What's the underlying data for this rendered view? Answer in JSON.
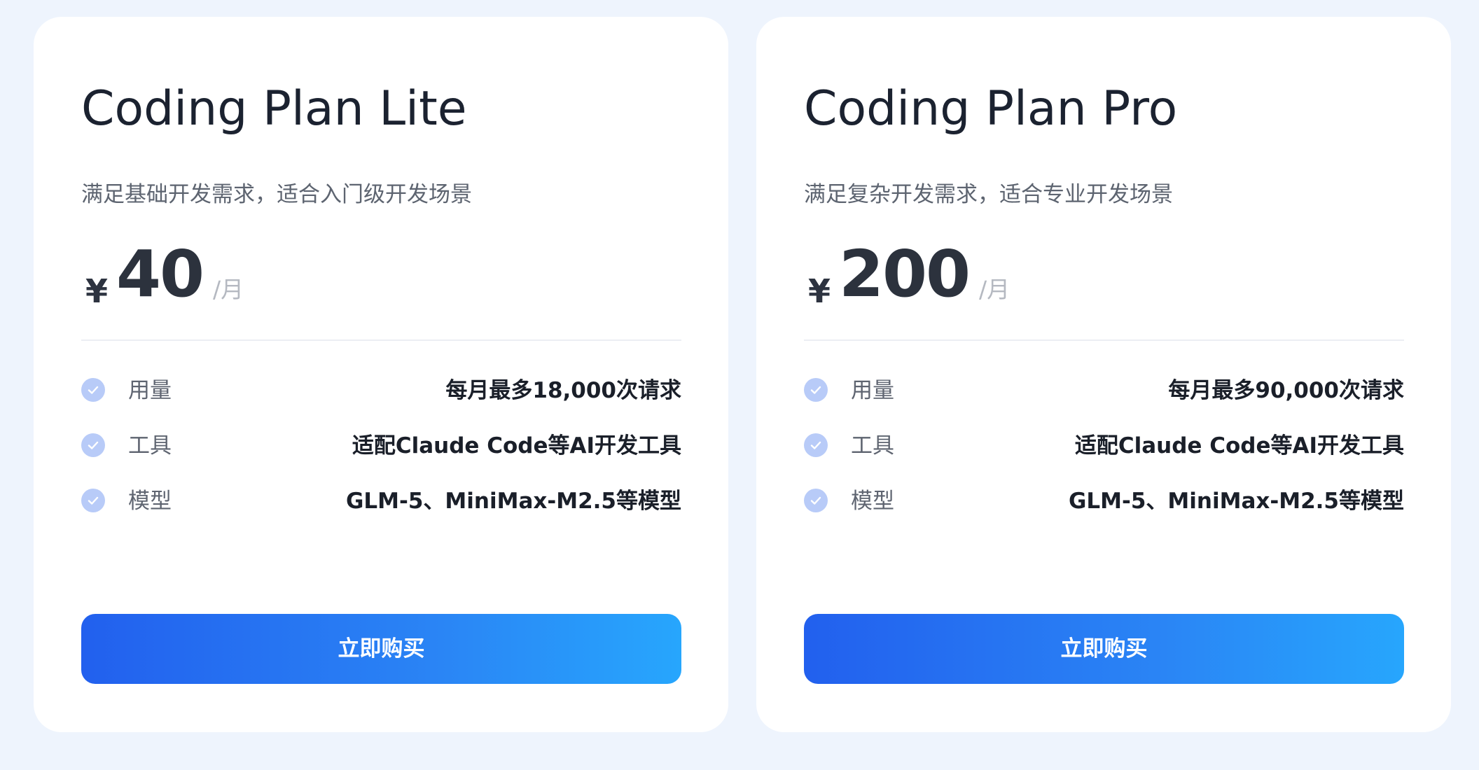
{
  "plans": [
    {
      "title": "Coding Plan Lite",
      "description": "满足基础开发需求，适合入门级开发场景",
      "currency": "¥",
      "price": "40",
      "period": "/月",
      "features": [
        {
          "label": "用量",
          "value": "每月最多18,000次请求",
          "icon": "check-circle-icon"
        },
        {
          "label": "工具",
          "value": "适配Claude Code等AI开发工具",
          "icon": "check-circle-icon"
        },
        {
          "label": "模型",
          "value": "GLM-5、MiniMax-M2.5等模型",
          "icon": "check-circle-icon"
        }
      ],
      "button_label": "立即购买"
    },
    {
      "title": "Coding Plan Pro",
      "description": "满足复杂开发需求，适合专业开发场景",
      "currency": "¥",
      "price": "200",
      "period": "/月",
      "features": [
        {
          "label": "用量",
          "value": "每月最多90,000次请求",
          "icon": "check-circle-icon"
        },
        {
          "label": "工具",
          "value": "适配Claude Code等AI开发工具",
          "icon": "check-circle-icon"
        },
        {
          "label": "模型",
          "value": "GLM-5、MiniMax-M2.5等模型",
          "icon": "check-circle-icon"
        }
      ],
      "button_label": "立即购买"
    }
  ],
  "colors": {
    "page_background": "#eef4fd",
    "card_background": "#ffffff",
    "check_icon": "#b8cbf8",
    "button_gradient_start": "#2260ee",
    "button_gradient_end": "#27a6fd",
    "title_text": "#1b2230",
    "secondary_text": "#5d6470"
  }
}
